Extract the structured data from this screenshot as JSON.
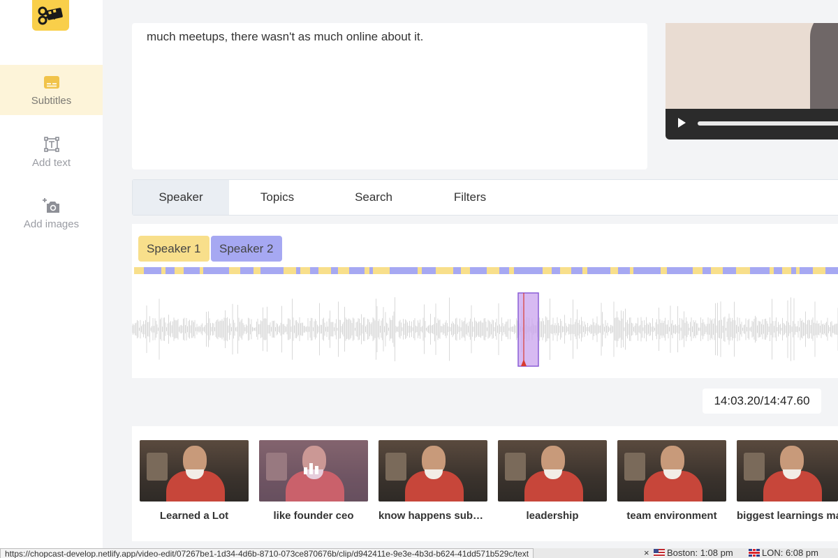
{
  "sidebar": {
    "items": [
      {
        "label": "Subtitles",
        "icon": "subtitles-icon",
        "active": true
      },
      {
        "label": "Add text",
        "icon": "text-box-icon",
        "active": false
      },
      {
        "label": "Add images",
        "icon": "add-photo-icon",
        "active": false
      }
    ]
  },
  "transcript": {
    "text": "much meetups, there wasn't as much online about it."
  },
  "tabs": [
    {
      "label": "Speaker",
      "active": true
    },
    {
      "label": "Topics",
      "active": false
    },
    {
      "label": "Search",
      "active": false
    },
    {
      "label": "Filters",
      "active": false
    }
  ],
  "speakers": [
    {
      "label": "Speaker 1",
      "color": "#f8df8b"
    },
    {
      "label": "Speaker 2",
      "color": "#a6a8f2"
    }
  ],
  "playback": {
    "time": "14:03.20/14:47.60",
    "current_seconds": 843.2,
    "duration_seconds": 887.6
  },
  "clips": [
    {
      "label": "Learned a Lot",
      "selected": false
    },
    {
      "label": "like founder ceo",
      "selected": true
    },
    {
      "label": "know happens subcons...",
      "selected": false
    },
    {
      "label": "leadership",
      "selected": false
    },
    {
      "label": "team environment",
      "selected": false
    },
    {
      "label": "biggest learnings ma",
      "selected": false
    }
  ],
  "statusbar": {
    "url": "https://chopcast-develop.netlify.app/video-edit/07267be1-1d34-4d6b-8710-073ce870676b/clip/d942411e-9e3e-4b3d-b624-41dd571b529c/text",
    "close": "×",
    "boston_time": "Boston: 1:08 pm",
    "london_time": "LON: 6:08 pm"
  },
  "colors": {
    "accent": "#f9cf4a",
    "speaker1": "#f8df8b",
    "speaker2": "#a6a8f2",
    "selection": "#c9a3ee",
    "playhead": "#d83a2f"
  }
}
